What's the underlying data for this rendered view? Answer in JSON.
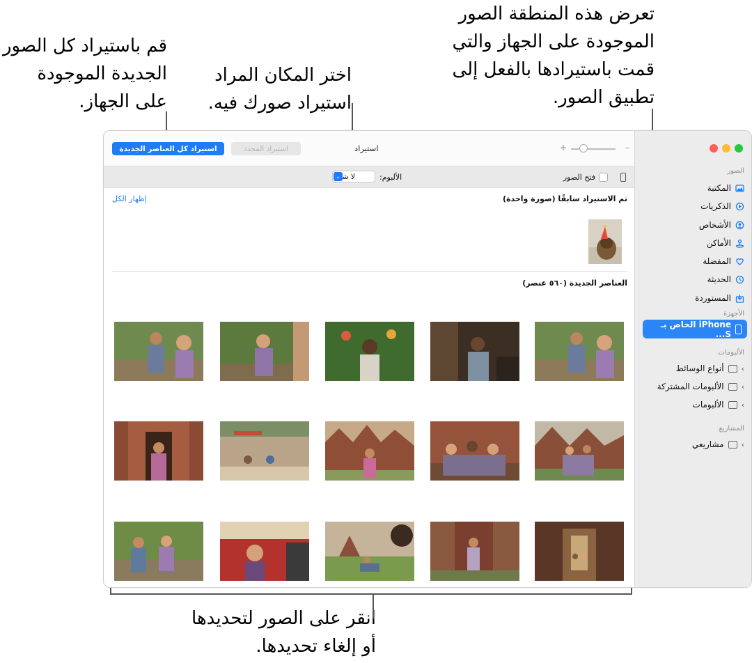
{
  "callouts": {
    "existing_photos": "تعرض هذه المنطقة الصور الموجودة على الجهاز والتي قمت باستيرادها بالفعل إلى تطبيق الصور.",
    "choose_location": "اختر المكان المراد استيراد صورك فيه.",
    "import_all": "قم باستيراد كل الصور الجديدة الموجودة على الجهاز.",
    "click_photos": "انقر على الصور لتحديدها أو إلغاء تحديدها."
  },
  "window_controls": [
    "close",
    "minimize",
    "zoom"
  ],
  "toolbar": {
    "title": "استيراد",
    "import_all_label": "استيراد كل العناصر الجديدة",
    "import_selected_label": "استيراد المحدد",
    "zoom_minus": "–",
    "zoom_plus": "+"
  },
  "options": {
    "open_photos_label": "فتح الصور",
    "album_label": "الألبوم:",
    "album_value": "لا شيء"
  },
  "previously_imported": {
    "title": "تم الاستيراد سابقًا (صورة واحدة)",
    "show_all": "إظهار الكل"
  },
  "new_items": {
    "title": "العناصر الجديدة (٥٦٠ عنصر)"
  },
  "sidebar": {
    "photos_section": "الصور",
    "items": [
      {
        "label": "المكتبة",
        "icon": "library-icon"
      },
      {
        "label": "الذكريات",
        "icon": "memories-icon"
      },
      {
        "label": "الأشخاص",
        "icon": "people-icon"
      },
      {
        "label": "الأماكن",
        "icon": "places-icon"
      },
      {
        "label": "المفضلة",
        "icon": "heart-icon"
      },
      {
        "label": "الحديثة",
        "icon": "clock-icon"
      },
      {
        "label": "المستوردة",
        "icon": "import-icon"
      }
    ],
    "devices_section": "الأجهزة",
    "device_label": "iPhone الخاص بـ S...",
    "albums_section": "الألبومات",
    "albums": [
      {
        "label": "أنواع الوسائط"
      },
      {
        "label": "الألبومات المشتركة"
      },
      {
        "label": "الألبومات"
      }
    ],
    "projects_section": "المشاريع",
    "projects": [
      {
        "label": "مشاريعي"
      }
    ]
  },
  "colors": {
    "accent": "#1f7cf4",
    "sidebar_bg": "#ececec",
    "selected_device": "#2a85f6"
  }
}
